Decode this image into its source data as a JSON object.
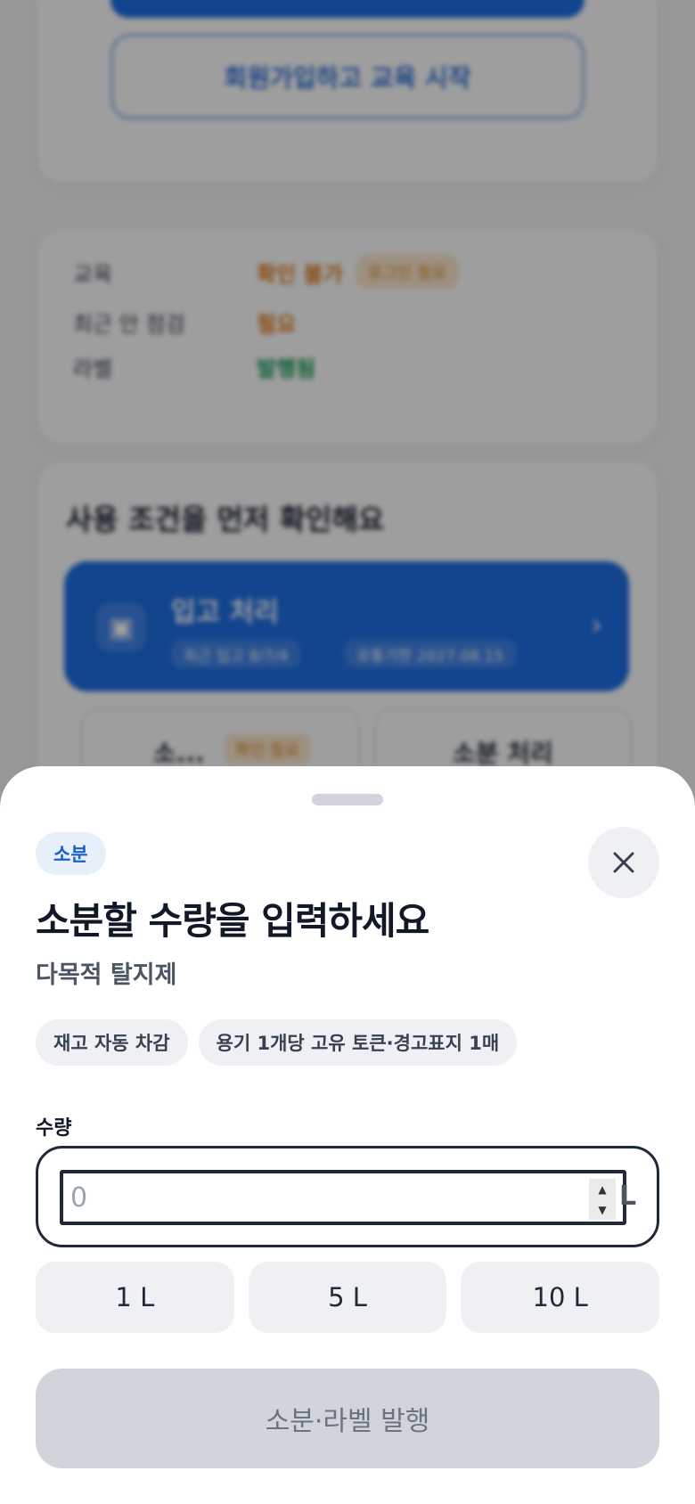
{
  "background": {
    "signup_button_label": "회원가입하고 교육 시작",
    "status_rows": [
      {
        "key": "교육",
        "value": "확인 불가",
        "tag": "로그인 필요"
      },
      {
        "key": "최근 안 점검",
        "value": "필요"
      },
      {
        "key": "라벨",
        "value": "발행됨"
      }
    ],
    "conditions_title": "사용 조건을 먼저 확인해요",
    "conditions_card": {
      "title": "입고 처리",
      "chip_1": "최근 입고 8/7/4",
      "chip_2": "유통기한 2027.08.15"
    },
    "sub_card_1": {
      "label": "소...",
      "tag": "확인 필요"
    },
    "sub_card_2": {
      "label": "소분 처리"
    }
  },
  "sheet": {
    "badge": "소분",
    "title": "소분할 수량을 입력하세요",
    "subtitle": "다목적 탈지제",
    "chips": [
      "재고 자동 차감",
      "용기 1개당 고유 토큰·경고표지 1매"
    ],
    "quantity_label": "수량",
    "quantity_placeholder": "0",
    "quantity_value": "",
    "unit": "L",
    "presets": [
      "1 L",
      "5 L",
      "10 L"
    ],
    "submit_label": "소분·라벨 발행"
  },
  "icons": {
    "close": "close-icon",
    "spinner_up": "chevron-up-icon",
    "spinner_down": "chevron-down-icon",
    "conditions_card": "box-icon",
    "conditions_chevron": "chevron-right-icon"
  },
  "colors": {
    "accent": "#1f6fe5",
    "badge_bg": "#e7effb",
    "badge_text": "#1a5fc8",
    "submit_disabled_bg": "#d1d5db",
    "submit_disabled_text": "#6b7280"
  }
}
